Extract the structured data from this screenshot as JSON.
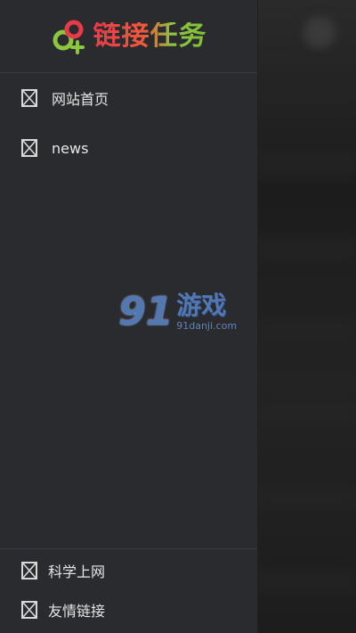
{
  "app": {
    "logo_text": "链接任务",
    "brand_colors": {
      "red": "#e93a4a",
      "green": "#8cc63f"
    }
  },
  "menu": {
    "items": [
      {
        "label": "网站首页",
        "icon": "broken-image-icon"
      },
      {
        "label": "news",
        "icon": "broken-image-icon"
      }
    ]
  },
  "footer": {
    "items": [
      {
        "label": "科学上网",
        "icon": "broken-image-icon"
      },
      {
        "label": "友情链接",
        "icon": "broken-image-icon"
      }
    ]
  },
  "watermark": {
    "number": "91",
    "name": "游戏",
    "site": "91danji.com"
  }
}
